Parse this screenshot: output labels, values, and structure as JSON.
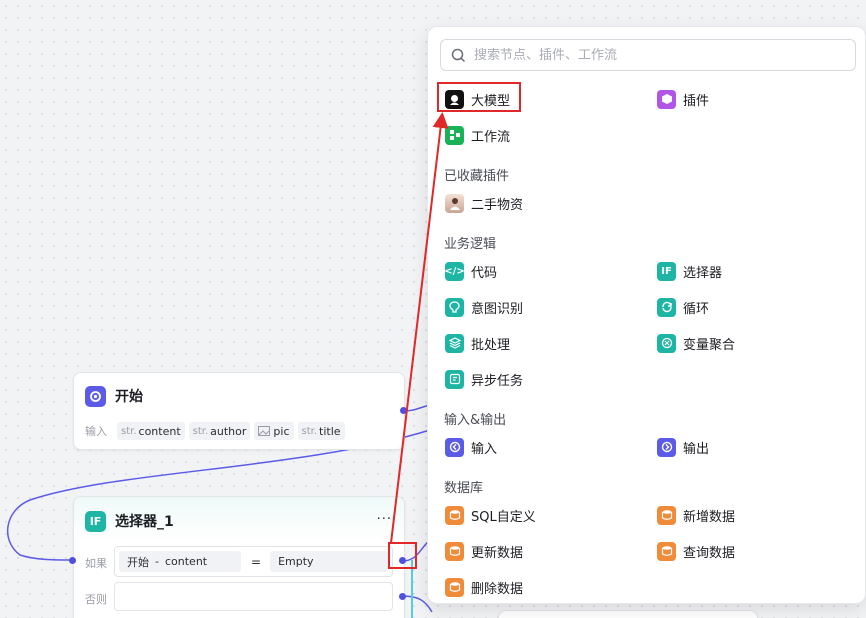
{
  "canvas": {
    "start_node": {
      "title": "开始",
      "input_label": "输入",
      "params": [
        {
          "type": "str.",
          "name": "content"
        },
        {
          "type": "str.",
          "name": "author"
        },
        {
          "type": "img",
          "name": "pic"
        },
        {
          "type": "str.",
          "name": "title"
        }
      ]
    },
    "selector_node": {
      "title": "选择器_1",
      "more": "···",
      "if_label": "如果",
      "else_label": "否则",
      "condition": {
        "left_source": "开始",
        "separator": "-",
        "left_field": "content",
        "operator": "=",
        "right": "Empty"
      }
    }
  },
  "panel": {
    "search_placeholder": "搜索节点、插件、工作流",
    "top_items": [
      {
        "label": "大模型",
        "icon": "llm-icon"
      },
      {
        "label": "插件",
        "icon": "plugin-icon"
      },
      {
        "label": "工作流",
        "icon": "workflow-icon"
      }
    ],
    "sections": [
      {
        "title": "已收藏插件",
        "items": [
          {
            "label": "二手物资",
            "icon": "avatar-icon"
          }
        ]
      },
      {
        "title": "业务逻辑",
        "items": [
          {
            "label": "代码",
            "icon": "code-icon"
          },
          {
            "label": "选择器",
            "icon": "if-icon"
          },
          {
            "label": "意图识别",
            "icon": "intent-icon"
          },
          {
            "label": "循环",
            "icon": "loop-icon"
          },
          {
            "label": "批处理",
            "icon": "batch-icon"
          },
          {
            "label": "变量聚合",
            "icon": "aggregate-icon"
          },
          {
            "label": "异步任务",
            "icon": "async-task-icon"
          }
        ]
      },
      {
        "title": "输入&输出",
        "items": [
          {
            "label": "输入",
            "icon": "input-icon"
          },
          {
            "label": "输出",
            "icon": "output-icon"
          }
        ]
      },
      {
        "title": "数据库",
        "items": [
          {
            "label": "SQL自定义",
            "icon": "sql-icon"
          },
          {
            "label": "新增数据",
            "icon": "db-add-icon"
          },
          {
            "label": "更新数据",
            "icon": "db-update-icon"
          },
          {
            "label": "查询数据",
            "icon": "db-query-icon"
          },
          {
            "label": "删除数据",
            "icon": "db-delete-icon"
          }
        ]
      }
    ]
  },
  "colors": {
    "accent": "#5b5be8",
    "teal": "#1fb5a5",
    "orange": "#f08b3a",
    "annotation_red": "#e02828"
  }
}
